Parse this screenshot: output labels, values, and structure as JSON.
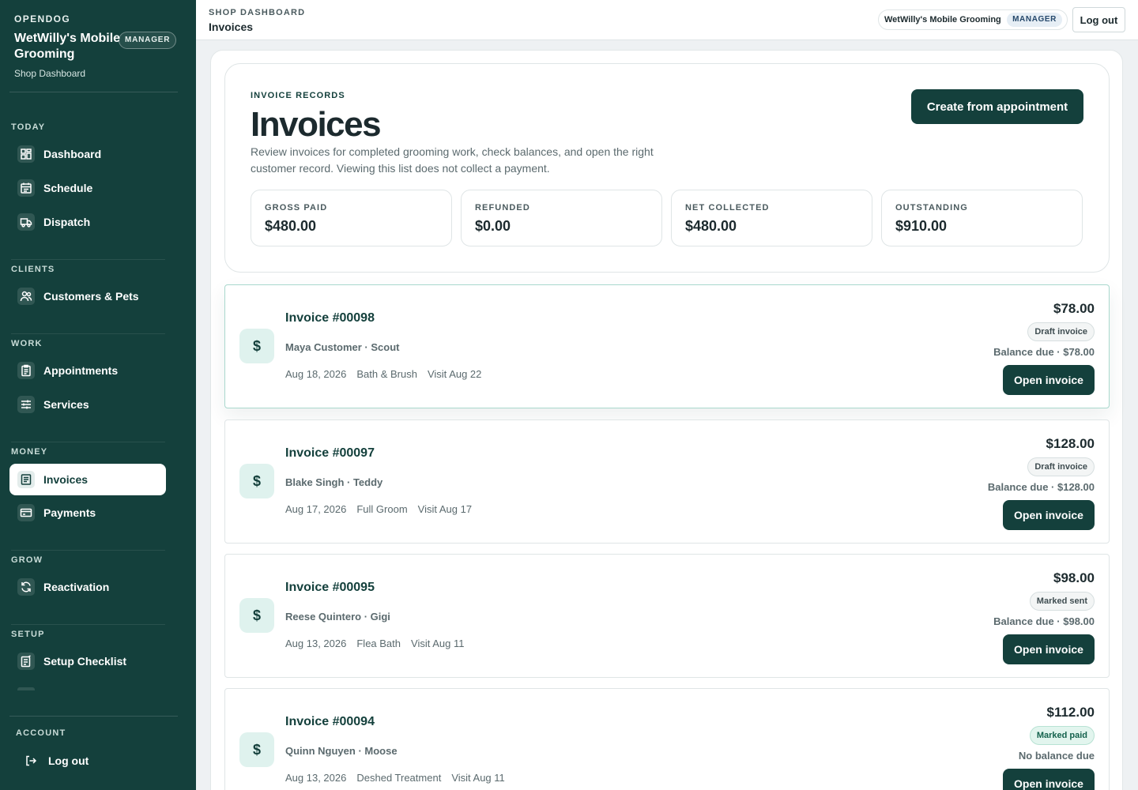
{
  "sidebar": {
    "brand": "OPENDOG",
    "shop_name": "WetWilly's Mobile Grooming",
    "role": "MANAGER",
    "shop_subtitle": "Shop Dashboard",
    "sections": {
      "today": "TODAY",
      "clients": "CLIENTS",
      "work": "WORK",
      "money": "MONEY",
      "grow": "GROW",
      "setup": "SETUP",
      "account": "ACCOUNT"
    },
    "items": {
      "dashboard": "Dashboard",
      "schedule": "Schedule",
      "dispatch": "Dispatch",
      "customers": "Customers & Pets",
      "appointments": "Appointments",
      "services": "Services",
      "invoices": "Invoices",
      "payments": "Payments",
      "reactivation": "Reactivation",
      "setup_checklist": "Setup Checklist",
      "logout": "Log out"
    },
    "active_item": "Invoices"
  },
  "header": {
    "eyebrow": "SHOP DASHBOARD",
    "title": "Invoices",
    "shop_chip": "WetWilly's Mobile Grooming",
    "role": "MANAGER",
    "logout": "Log out"
  },
  "hero": {
    "eyebrow": "INVOICE RECORDS",
    "title": "Invoices",
    "description": "Review invoices for completed grooming work, check balances, and open the right customer record. Viewing this list does not collect a payment.",
    "create_button": "Create from appointment"
  },
  "stats": [
    {
      "label": "GROSS PAID",
      "value": "$480.00"
    },
    {
      "label": "REFUNDED",
      "value": "$0.00"
    },
    {
      "label": "NET COLLECTED",
      "value": "$480.00"
    },
    {
      "label": "OUTSTANDING",
      "value": "$910.00"
    }
  ],
  "invoices": [
    {
      "icon": "$",
      "number": "Invoice #00098",
      "client": "Maya Customer · Scout",
      "date": "Aug 18, 2026",
      "service": "Bath & Brush",
      "visit": "Visit Aug 22",
      "amount": "$78.00",
      "status": "Draft invoice",
      "balance": "Balance due · $78.00",
      "action": "Open invoice"
    },
    {
      "icon": "$",
      "number": "Invoice #00097",
      "client": "Blake Singh · Teddy",
      "date": "Aug 17, 2026",
      "service": "Full Groom",
      "visit": "Visit Aug 17",
      "amount": "$128.00",
      "status": "Draft invoice",
      "balance": "Balance due · $128.00",
      "action": "Open invoice"
    },
    {
      "icon": "$",
      "number": "Invoice #00095",
      "client": "Reese Quintero · Gigi",
      "date": "Aug 13, 2026",
      "service": "Flea Bath",
      "visit": "Visit Aug 11",
      "amount": "$98.00",
      "status": "Marked sent",
      "balance": "Balance due · $98.00",
      "action": "Open invoice"
    },
    {
      "icon": "$",
      "number": "Invoice #00094",
      "client": "Quinn Nguyen · Moose",
      "date": "Aug 13, 2026",
      "service": "Deshed Treatment",
      "visit": "Visit Aug 11",
      "amount": "$112.00",
      "status": "Marked paid",
      "balance": "No balance due",
      "action": "Open invoice"
    }
  ],
  "colors": {
    "sidebar_bg": "#14403c",
    "accent": "#14403c",
    "page_bg": "#eef1f3",
    "paid_badge": "#e2f5ee"
  }
}
